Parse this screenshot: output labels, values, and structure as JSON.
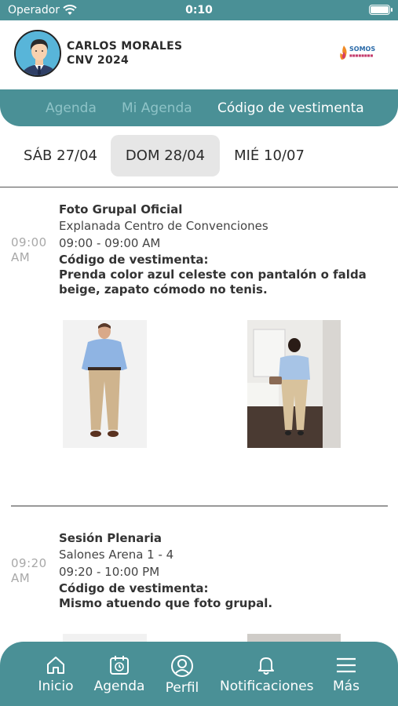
{
  "status_bar": {
    "carrier": "Operador",
    "time": "0:10"
  },
  "header": {
    "user_name": "CARLOS MORALES",
    "event_name": "CNV 2024",
    "logo_text": "SOMOS"
  },
  "tabs": [
    {
      "label": "Agenda",
      "active": false
    },
    {
      "label": "Mi Agenda",
      "active": false
    },
    {
      "label": "Código de vestimenta",
      "active": true
    }
  ],
  "dates": [
    {
      "label": "SÁB 27/04",
      "selected": false
    },
    {
      "label": "DOM 28/04",
      "selected": true
    },
    {
      "label": "MIÉ 10/07",
      "selected": false
    }
  ],
  "agenda": [
    {
      "time": "09:00",
      "ampm": "AM",
      "title": "Foto Grupal Oficial",
      "place": "Explanada Centro de Convenciones",
      "range": "09:00 - 09:00 AM",
      "dress_label": "Código de vestimenta:",
      "dress_text": "Prenda color azul celeste  con pantalón o falda beige, zapato cómodo no tenis."
    },
    {
      "time": "09:20",
      "ampm": "AM",
      "title": "Sesión Plenaria",
      "place": "Salones Arena 1 - 4",
      "range": "09:20 - 10:00 PM",
      "dress_label": "Código de vestimenta:",
      "dress_text": "Mismo atuendo que foto grupal."
    }
  ],
  "bottom_nav": [
    {
      "label": "Inicio",
      "icon": "home-icon"
    },
    {
      "label": "Agenda",
      "icon": "calendar-icon"
    },
    {
      "label": "Perfil",
      "icon": "profile-icon"
    },
    {
      "label": "Notificaciones",
      "icon": "bell-icon"
    },
    {
      "label": "Más",
      "icon": "menu-icon"
    }
  ],
  "colors": {
    "primary": "#4a9096",
    "tab_inactive": "#8ec3c7",
    "date_selected_bg": "#e6e6e6"
  }
}
